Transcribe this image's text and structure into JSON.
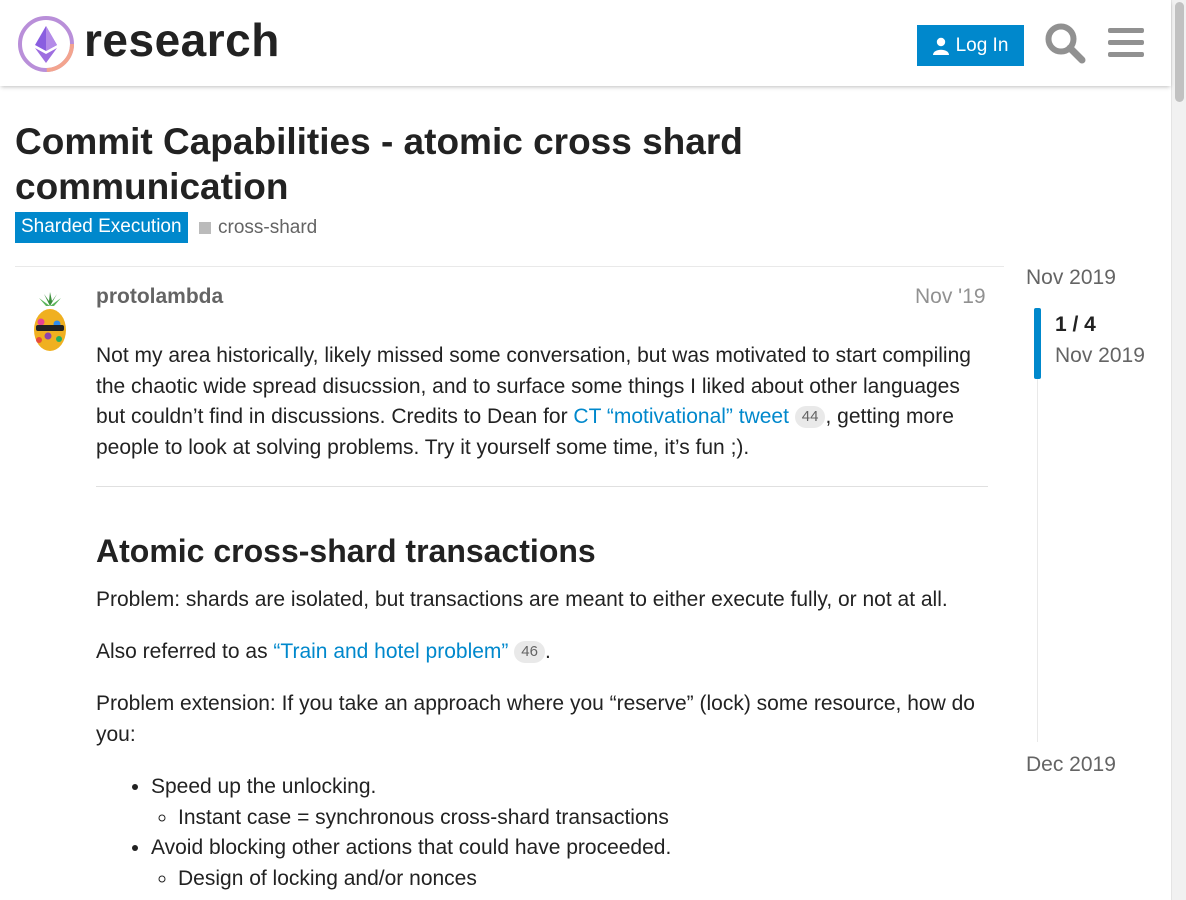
{
  "header": {
    "logo_text": "research",
    "login_label": "Log In"
  },
  "topic": {
    "title": "Commit Capabilities - atomic cross shard communication",
    "category": "Sharded Execution",
    "tag": "cross-shard"
  },
  "post": {
    "username": "protolambda",
    "date": "Nov '19",
    "intro_text": "Not my area historically, likely missed some conversation, but was motivated to start compiling the chaotic wide spread disucssion, and to surface some things I liked about other languages but couldn’t find in discussions. Credits to Dean for ",
    "intro_link": "CT “motivational” tweet",
    "intro_link_clicks": "44",
    "intro_text_after": ", getting more people to look at solving problems. Try it yourself some time, it’s fun ;).",
    "heading": "Atomic cross-shard transactions",
    "problem": "Problem: shards are isolated, but transactions are meant to either execute fully, or not at all.",
    "also_prefix": "Also referred to as ",
    "also_link": "“Train and hotel problem”",
    "also_link_clicks": "46",
    "also_suffix": ".",
    "extension": "Problem extension: If you take an approach where you “reserve” (lock) some resource, how do you:",
    "list": [
      {
        "text": "Speed up the unlocking.",
        "sub": "Instant case = synchronous cross-shard transactions"
      },
      {
        "text": "Avoid blocking other actions that could have proceeded.",
        "sub": "Design of locking and/or nonces"
      }
    ]
  },
  "timeline": {
    "start": "Nov 2019",
    "position": "1 / 4",
    "position_date": "Nov 2019",
    "end": "Dec 2019"
  },
  "colors": {
    "accent": "#0088cc",
    "muted": "#646464"
  }
}
